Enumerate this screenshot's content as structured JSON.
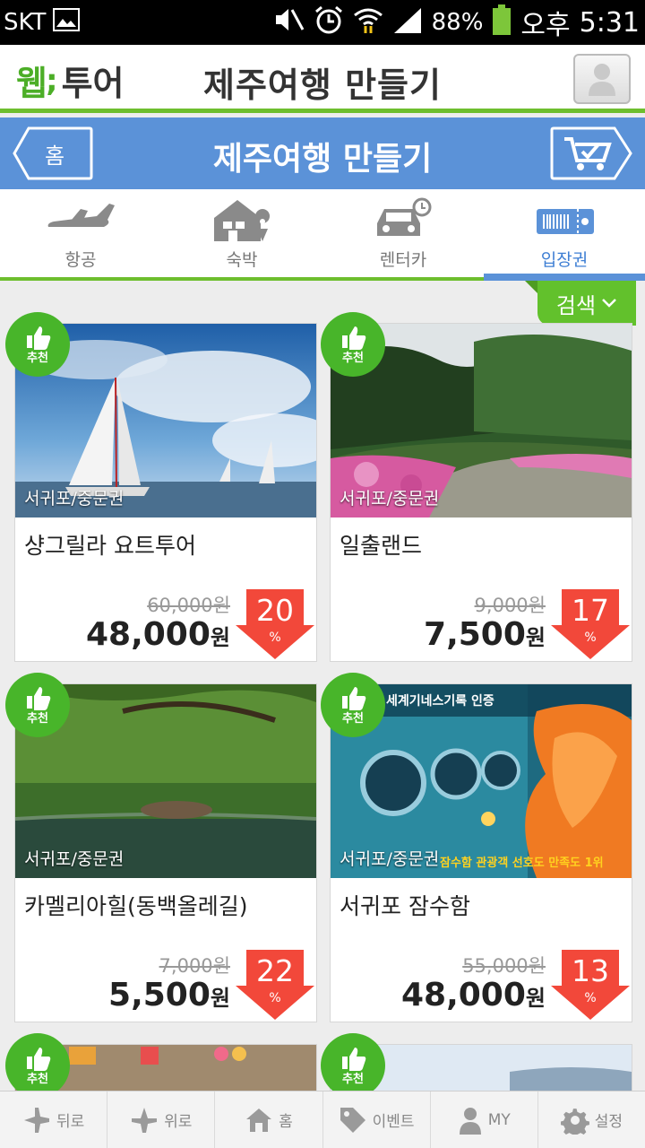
{
  "status_bar": {
    "carrier": "SKT",
    "battery": "88%",
    "ampm": "오후",
    "time": "5:31"
  },
  "header": {
    "logo_part1": "웹",
    "logo_part2": "투어",
    "title": "제주여행 만들기"
  },
  "nav_bar": {
    "home_label": "홈",
    "title": "제주여행 만들기"
  },
  "tabs": [
    {
      "label": "항공",
      "icon": "airplane-icon"
    },
    {
      "label": "숙박",
      "icon": "house-pin-icon"
    },
    {
      "label": "렌터카",
      "icon": "car-icon"
    },
    {
      "label": "입장권",
      "icon": "ticket-icon",
      "active": true
    }
  ],
  "search_button": "검색",
  "badge_label": "추천",
  "products": [
    {
      "region": "서귀포/중문권",
      "name": "샹그릴라 요트투어",
      "original_price": "60,000원",
      "sale_price": "48,000",
      "currency": "원",
      "discount": "20",
      "pct": "%"
    },
    {
      "region": "서귀포/중문권",
      "name": "일출랜드",
      "original_price": "9,000원",
      "sale_price": "7,500",
      "currency": "원",
      "discount": "17",
      "pct": "%"
    },
    {
      "region": "서귀포/중문권",
      "name": "카멜리아힐(동백올레길)",
      "original_price": "7,000원",
      "sale_price": "5,500",
      "currency": "원",
      "discount": "22",
      "pct": "%"
    },
    {
      "region": "서귀포/중문권",
      "name": "서귀포 잠수함",
      "original_price": "55,000원",
      "sale_price": "48,000",
      "currency": "원",
      "discount": "13",
      "pct": "%"
    }
  ],
  "submarine_banner": {
    "top": "세계기네스기록 인증",
    "bottom": "잠수함 관광객 선호도 만족도 1위"
  },
  "bottom_nav": [
    {
      "label": "뒤로",
      "icon": "plane-back-icon"
    },
    {
      "label": "위로",
      "icon": "plane-up-icon"
    },
    {
      "label": "홈",
      "icon": "home-icon"
    },
    {
      "label": "이벤트",
      "icon": "tag-icon"
    },
    {
      "label": "MY",
      "icon": "person-icon"
    },
    {
      "label": "설정",
      "icon": "gear-icon"
    }
  ],
  "colors": {
    "green": "#6dbe2e",
    "blue": "#5b92d8",
    "discount_red": "#f2483a"
  }
}
